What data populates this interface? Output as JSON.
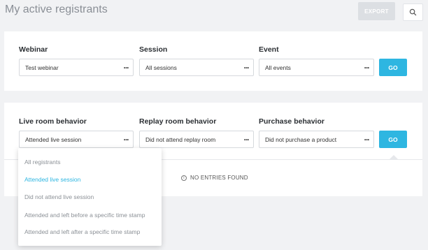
{
  "header": {
    "title": "My active registrants",
    "export_label": "EXPORT",
    "search_icon": "search-icon"
  },
  "filters_top": {
    "webinar": {
      "label": "Webinar",
      "value": "Test webinar"
    },
    "session": {
      "label": "Session",
      "value": "All sessions"
    },
    "event": {
      "label": "Event",
      "value": "All events"
    },
    "go_label": "GO"
  },
  "filters_behavior": {
    "live": {
      "label": "Live room behavior",
      "value": "Attended live session"
    },
    "replay": {
      "label": "Replay room behavior",
      "value": "Did not attend replay room"
    },
    "purchase": {
      "label": "Purchase behavior",
      "value": "Did not purchase a product"
    },
    "go_label": "GO"
  },
  "results": {
    "empty_message": "NO ENTRIES FOUND",
    "info_icon": "i"
  },
  "live_dropdown": {
    "options": [
      "All registrants",
      "Attended live session",
      "Did not attend live session",
      "Attended and left before a specific time stamp",
      "Attended and left after a specific time stamp"
    ],
    "selected": "Attended live session"
  },
  "colors": {
    "accent": "#2eb6e1",
    "background": "#f1f2f4",
    "disabled_button": "#dcdfe3"
  }
}
